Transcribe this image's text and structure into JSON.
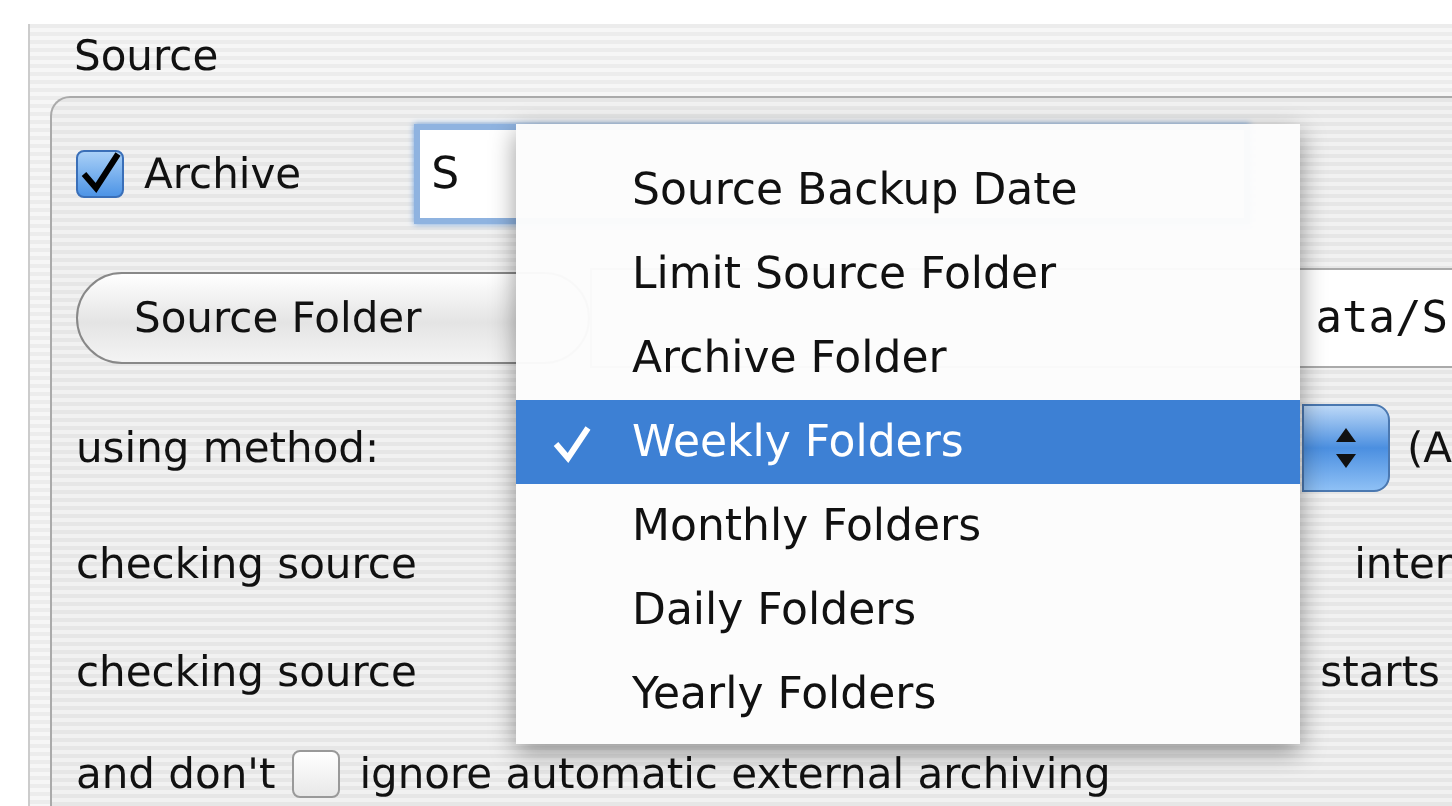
{
  "group": {
    "title": "Source"
  },
  "archive": {
    "label": "Archive",
    "checked": true,
    "field_value": "S"
  },
  "source_folder": {
    "button": "Source Folder",
    "path": "ata/S"
  },
  "method": {
    "label": "using method:",
    "trailing": "(A"
  },
  "rows": [
    {
      "label": "checking source",
      "trailing": "inter"
    },
    {
      "label": "checking source",
      "trailing": "starts"
    }
  ],
  "last_row": {
    "label": "and don't",
    "checked": false,
    "text": "ignore automatic external archiving"
  },
  "menu": {
    "items": [
      {
        "label": "Source Backup Date",
        "selected": false
      },
      {
        "label": "Limit Source Folder",
        "selected": false
      },
      {
        "label": "Archive Folder",
        "selected": false
      },
      {
        "label": "Weekly Folders",
        "selected": true
      },
      {
        "label": "Monthly Folders",
        "selected": false
      },
      {
        "label": "Daily Folders",
        "selected": false
      },
      {
        "label": "Yearly Folders",
        "selected": false
      }
    ]
  }
}
